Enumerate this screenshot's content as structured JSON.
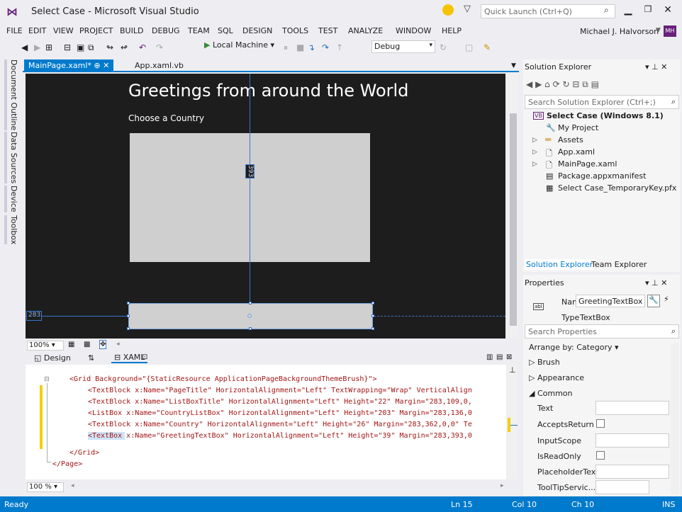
{
  "window": {
    "title": "Select Case - Microsoft Visual Studio",
    "quick_launch_placeholder": "Quick Launch (Ctrl+Q)",
    "logo": "vs-logo-icon",
    "controls": [
      "minimize",
      "maximize",
      "close"
    ]
  },
  "menu": {
    "items": [
      "FILE",
      "EDIT",
      "VIEW",
      "PROJECT",
      "BUILD",
      "DEBUG",
      "TEAM",
      "SQL",
      "DESIGN",
      "TOOLS",
      "TEST",
      "ANALYZE",
      "WINDOW",
      "HELP"
    ],
    "user_name": "Michael J. Halvorson",
    "user_initials": "MH"
  },
  "toolbar": {
    "run_target": "Local Machine",
    "configuration": "Debug"
  },
  "left_tabs": [
    "Document Outline",
    "Data Sources",
    "Device",
    "Toolbox"
  ],
  "doc_tabs": {
    "active": "MainPage.xaml*",
    "other": "App.xaml.vb"
  },
  "designer": {
    "page_title": "Greetings from around the World",
    "list_title": "Choose a Country",
    "margin_top": "393",
    "margin_left": "283",
    "zoom": "100%"
  },
  "split_tabs": {
    "design": "Design",
    "xaml": "XAML"
  },
  "code": {
    "lines": [
      {
        "indent": 0,
        "text": "<Grid Background=\"{StaticResource ApplicationPageBackgroundThemeBrush}\">"
      },
      {
        "indent": 1,
        "text": "<TextBlock x:Name=\"PageTitle\" HorizontalAlignment=\"Left\" TextWrapping=\"Wrap\" VerticalAlign"
      },
      {
        "indent": 1,
        "text": "<TextBlock x:Name=\"ListBoxTitle\" HorizontalAlignment=\"Left\" Height=\"22\" Margin=\"283,109,0,"
      },
      {
        "indent": 1,
        "text": "<ListBox x:Name=\"CountryListBox\" HorizontalAlignment=\"Left\" Height=\"203\" Margin=\"283,136,0"
      },
      {
        "indent": 1,
        "text": "<TextBlock x:Name=\"Country\" HorizontalAlignment=\"Left\" Height=\"26\" Margin=\"283,362,0,0\" Te"
      },
      {
        "indent": 1,
        "text": "<TextBox x:Name=\"GreetingTextBox\" HorizontalAlignment=\"Left\" Height=\"39\" Margin=\"283,393,0"
      },
      {
        "indent": 0,
        "text": ""
      },
      {
        "indent": 0,
        "text": "</Grid>"
      },
      {
        "indent": -1,
        "text": "</Page>"
      }
    ],
    "zoom": "100 %"
  },
  "solution_explorer": {
    "title": "Solution Explorer",
    "search_placeholder": "Search Solution Explorer (Ctrl+;)",
    "project": "Select Case (Windows 8.1)",
    "items": [
      {
        "label": "My Project",
        "expandable": false,
        "icon": "wrench-icon"
      },
      {
        "label": "Assets",
        "expandable": true,
        "icon": "folder-icon"
      },
      {
        "label": "App.xaml",
        "expandable": true,
        "icon": "xaml-file-icon"
      },
      {
        "label": "MainPage.xaml",
        "expandable": true,
        "icon": "xaml-file-icon"
      },
      {
        "label": "Package.appxmanifest",
        "expandable": false,
        "icon": "manifest-icon"
      },
      {
        "label": "Select Case_TemporaryKey.pfx",
        "expandable": false,
        "icon": "certificate-icon"
      }
    ],
    "bottom_tabs": [
      "Solution Explorer",
      "Team Explorer"
    ]
  },
  "properties": {
    "title": "Properties",
    "name_label": "Name",
    "name_value": "GreetingTextBox",
    "type_label": "Type",
    "type_value": "TextBox",
    "search_placeholder": "Search Properties",
    "arrange_by": "Arrange by: Category",
    "categories": {
      "brush": "Brush",
      "appearance": "Appearance",
      "common": "Common"
    },
    "props": [
      {
        "label": "Text",
        "kind": "text"
      },
      {
        "label": "AcceptsReturn",
        "kind": "check"
      },
      {
        "label": "InputScope",
        "kind": "text"
      },
      {
        "label": "IsReadOnly",
        "kind": "check"
      },
      {
        "label": "PlaceholderText",
        "kind": "text"
      },
      {
        "label": "ToolTipServic...",
        "kind": "text"
      }
    ]
  },
  "status": {
    "state": "Ready",
    "line": "Ln 15",
    "col": "Col 10",
    "ch": "Ch 10",
    "mode": "INS"
  },
  "colors": {
    "accent": "#007acc",
    "canvas": "#1d1d1d",
    "highlight_bar": "#f3d000"
  }
}
